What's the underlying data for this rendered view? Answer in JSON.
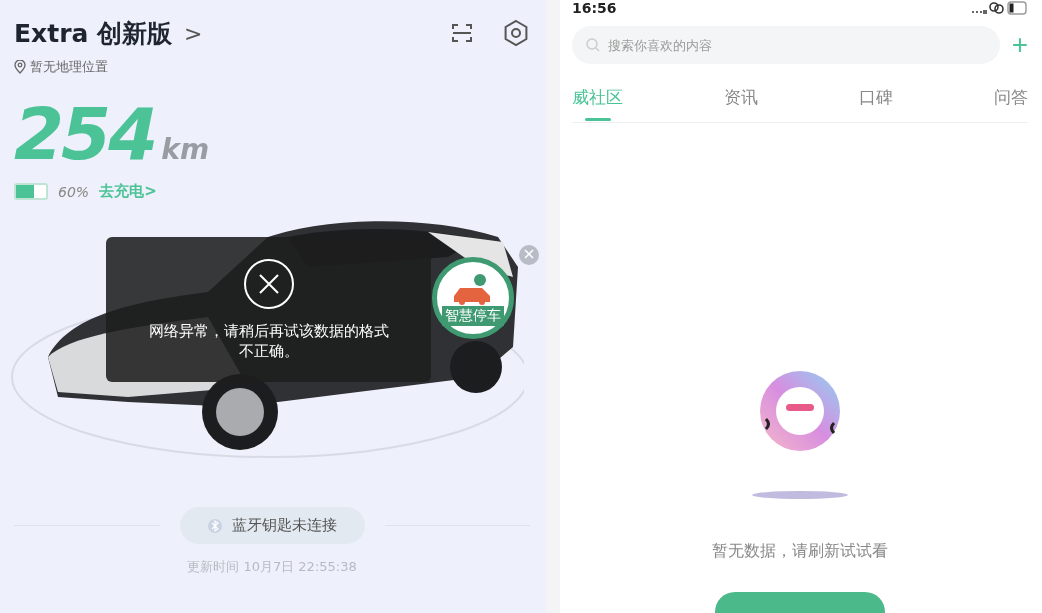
{
  "vehicle": {
    "model": "Extra 创新版",
    "chevron": ">",
    "location": "暂无地理位置",
    "range": "254",
    "range_unit": "km",
    "battery": {
      "level": 0.6,
      "percent": "60%"
    },
    "charge_link": "去充电>",
    "parking_badge": "智慧停车",
    "toast": "网络异常，请稍后再试该数据的格式不正确。",
    "bluetooth_key": "蓝牙钥匙未连接",
    "updated": "更新时间 10月7日 22:55:38"
  },
  "community": {
    "status_time": "16:56",
    "search": {
      "placeholder": "搜索你喜欢的内容"
    },
    "plus": "+",
    "tabs": [
      {
        "label": "威社区",
        "selected": true
      },
      {
        "label": "资讯",
        "selected": false
      },
      {
        "label": "口碑",
        "selected": false
      },
      {
        "label": "问答",
        "selected": false
      }
    ],
    "empty_message": "暂无数据，请刷新试试看"
  }
}
